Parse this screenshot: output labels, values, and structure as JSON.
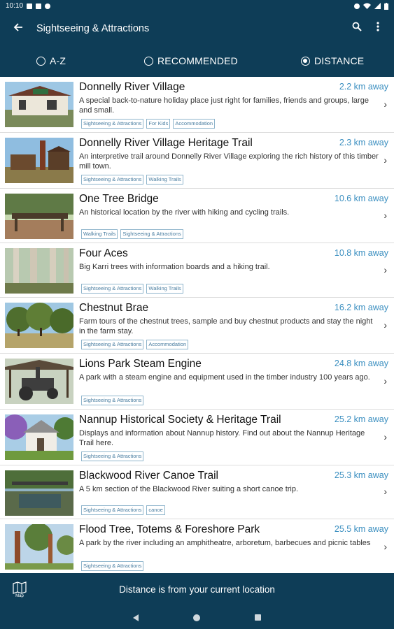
{
  "status": {
    "time": "10:10"
  },
  "appbar": {
    "title": "Sightseeing & Attractions"
  },
  "sort": {
    "options": [
      {
        "label": "A-Z",
        "selected": false
      },
      {
        "label": "RECOMMENDED",
        "selected": false
      },
      {
        "label": "DISTANCE",
        "selected": true
      }
    ]
  },
  "list": [
    {
      "name": "Donnelly River Village",
      "distance": "2.2 km away",
      "description": "A special back-to-nature holiday place just right for families, friends and groups, large and small.",
      "tags": [
        "Sightseeing & Attractions",
        "For Kids",
        "Accommodation"
      ]
    },
    {
      "name": "Donnelly River Village Heritage Trail",
      "distance": "2.3 km away",
      "description": "An interpretive trail around Donnelly River Village exploring the rich history of this timber mill town.",
      "tags": [
        "Sightseeing & Attractions",
        "Walking Trails"
      ]
    },
    {
      "name": "One Tree Bridge",
      "distance": "10.6 km away",
      "description": "An historical location by the river with hiking and cycling trails.",
      "tags": [
        "Walking Trails",
        "Sightseeing & Attractions"
      ]
    },
    {
      "name": "Four Aces",
      "distance": "10.8 km away",
      "description": "Big Karri trees with information boards and a hiking trail.",
      "tags": [
        "Sightseeing & Attractions",
        "Walking Trails"
      ]
    },
    {
      "name": "Chestnut Brae",
      "distance": "16.2 km away",
      "description": "Farm tours of the chestnut trees, sample and buy chestnut products and stay the night in the farm stay.",
      "tags": [
        "Sightseeing & Attractions",
        "Accommodation"
      ]
    },
    {
      "name": "Lions Park Steam Engine",
      "distance": "24.8 km away",
      "description": "A park with a steam engine and equipment used in the timber industry 100 years ago.",
      "tags": [
        "Sightseeing & Attractions"
      ]
    },
    {
      "name": "Nannup Historical Society & Heritage Trail",
      "distance": "25.2 km away",
      "description": "Displays and information about Nannup history. Find out about the Nannup Heritage Trail here.",
      "tags": [
        "Sightseeing & Attractions"
      ]
    },
    {
      "name": "Blackwood River Canoe Trail",
      "distance": "25.3 km away",
      "description": "A 5 km section of the Blackwood River suiting a short canoe trip.",
      "tags": [
        "Sightseeing & Attractions",
        "canoe"
      ]
    },
    {
      "name": "Flood Tree, Totems & Foreshore Park",
      "distance": "25.5 km away",
      "description": "A park by the river including an amphitheatre, arboretum, barbecues and picnic tables",
      "tags": [
        "Sightseeing & Attractions"
      ]
    }
  ],
  "bottombar": {
    "map_label": "Map",
    "message": "Distance is from your current location"
  },
  "colors": {
    "primary": "#0e3d57",
    "distance": "#3b8fc0",
    "tag": "#4a7ea1"
  }
}
